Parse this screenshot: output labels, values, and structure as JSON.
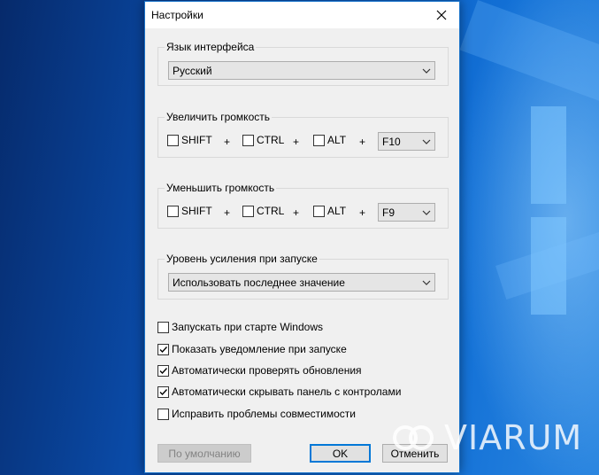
{
  "window": {
    "title": "Настройки"
  },
  "language": {
    "label": "Язык интерфейса",
    "value": "Русский"
  },
  "volume_up": {
    "label": "Увеличить громкость",
    "shift": "SHIFT",
    "ctrl": "CTRL",
    "alt": "ALT",
    "plus": "+",
    "key": "F10"
  },
  "volume_down": {
    "label": "Уменьшить громкость",
    "shift": "SHIFT",
    "ctrl": "CTRL",
    "alt": "ALT",
    "plus": "+",
    "key": "F9"
  },
  "gain": {
    "label": "Уровень усиления при запуске",
    "value": "Использовать последнее значение"
  },
  "options": [
    {
      "label": "Запускать при старте Windows",
      "checked": false
    },
    {
      "label": "Показать уведомление при запуске",
      "checked": true
    },
    {
      "label": "Автоматически проверять обновления",
      "checked": true
    },
    {
      "label": "Автоматически скрывать панель с контролами",
      "checked": true
    },
    {
      "label": "Исправить проблемы совместимости",
      "checked": false
    }
  ],
  "buttons": {
    "defaults": "По умолчанию",
    "ok": "OK",
    "cancel": "Отменить"
  },
  "watermark": {
    "text": "VIARUM"
  },
  "colors": {
    "accent": "#0078d7",
    "window_bg": "#f0f0f0"
  }
}
